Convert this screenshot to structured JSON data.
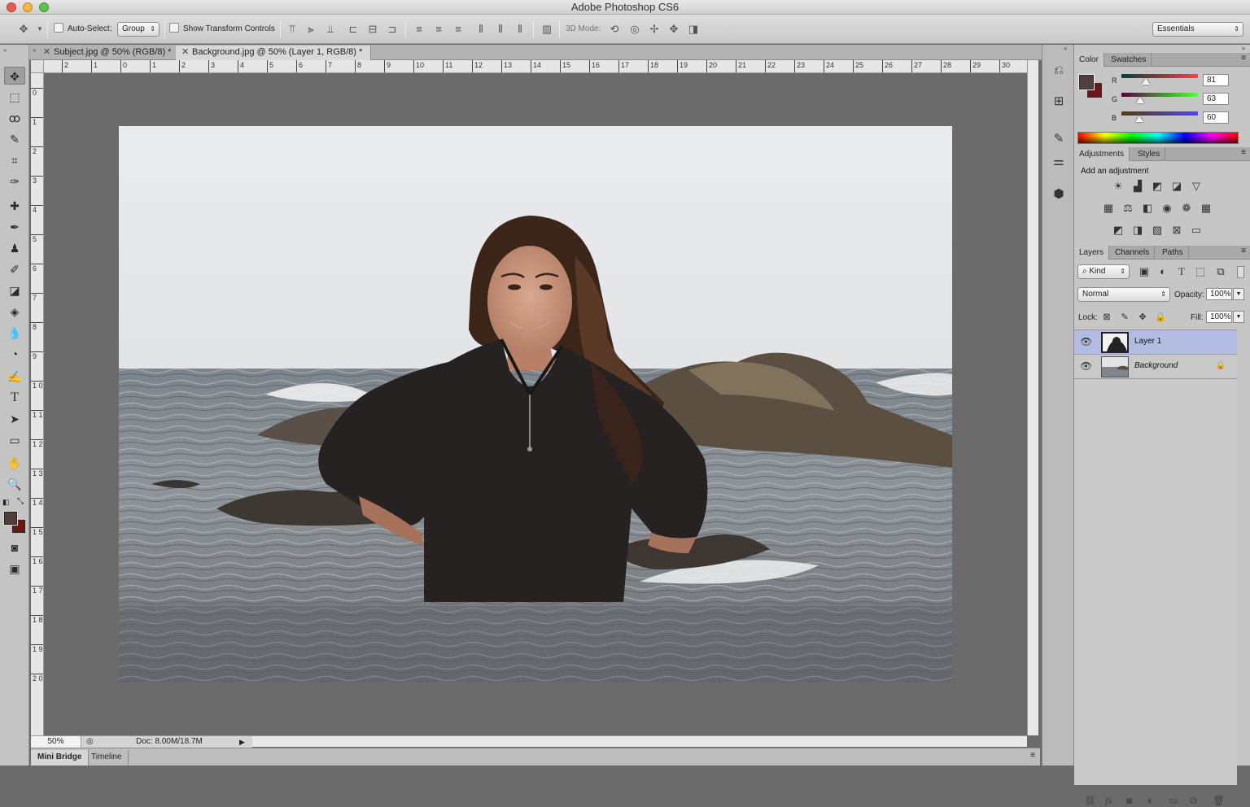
{
  "app": {
    "title": "Adobe Photoshop CS6"
  },
  "options_bar": {
    "auto_select_label": "Auto-Select:",
    "auto_select_value": "Group",
    "show_transform_label": "Show Transform Controls",
    "three_d_mode_label": "3D Mode:",
    "workspace": "Essentials"
  },
  "documents": {
    "tabs": [
      {
        "label": "Subject.jpg @ 50% (RGB/8) *"
      },
      {
        "label": "Background.jpg @ 50% (Layer 1, RGB/8) *"
      }
    ]
  },
  "rulers": {
    "horizontal": [
      "2",
      "1",
      "0",
      "1",
      "2",
      "3",
      "4",
      "5",
      "6",
      "7",
      "8",
      "9",
      "10",
      "11",
      "12",
      "13",
      "14",
      "15",
      "16",
      "17",
      "18",
      "19",
      "20",
      "21",
      "22",
      "23",
      "24",
      "25",
      "26",
      "27",
      "28",
      "29",
      "30"
    ],
    "vertical": [
      "1",
      "0",
      "1",
      "2",
      "3",
      "4",
      "5",
      "6",
      "7",
      "8",
      "9",
      "1 0",
      "1 1",
      "1 2",
      "1 3",
      "1 4",
      "1 5",
      "1 6",
      "1 7",
      "1 8",
      "1 9",
      "2 0"
    ]
  },
  "status": {
    "zoom": "50%",
    "doc_info": "Doc: 8.00M/18.7M"
  },
  "bottom_tabs": [
    {
      "label": "Mini Bridge"
    },
    {
      "label": "Timeline"
    }
  ],
  "color_panel": {
    "tabs": [
      "Color",
      "Swatches"
    ],
    "foreground_color": "#513f3c",
    "background_color": "#6e1515",
    "channels": [
      {
        "label": "R",
        "value": "81",
        "fraction": 0.318
      },
      {
        "label": "G",
        "value": "63",
        "fraction": 0.247
      },
      {
        "label": "B",
        "value": "60",
        "fraction": 0.235
      }
    ]
  },
  "adjustments_panel": {
    "tabs": [
      "Adjustments",
      "Styles"
    ],
    "heading": "Add an adjustment"
  },
  "layers_panel": {
    "tabs": [
      "Layers",
      "Channels",
      "Paths"
    ],
    "filter_kind": "Kind",
    "blend_mode": "Normal",
    "opacity_label": "Opacity:",
    "opacity_value": "100%",
    "lock_label": "Lock:",
    "fill_label": "Fill:",
    "fill_value": "100%",
    "layers": [
      {
        "name": "Layer 1",
        "selected": true
      },
      {
        "name": "Background",
        "selected": false
      }
    ]
  }
}
